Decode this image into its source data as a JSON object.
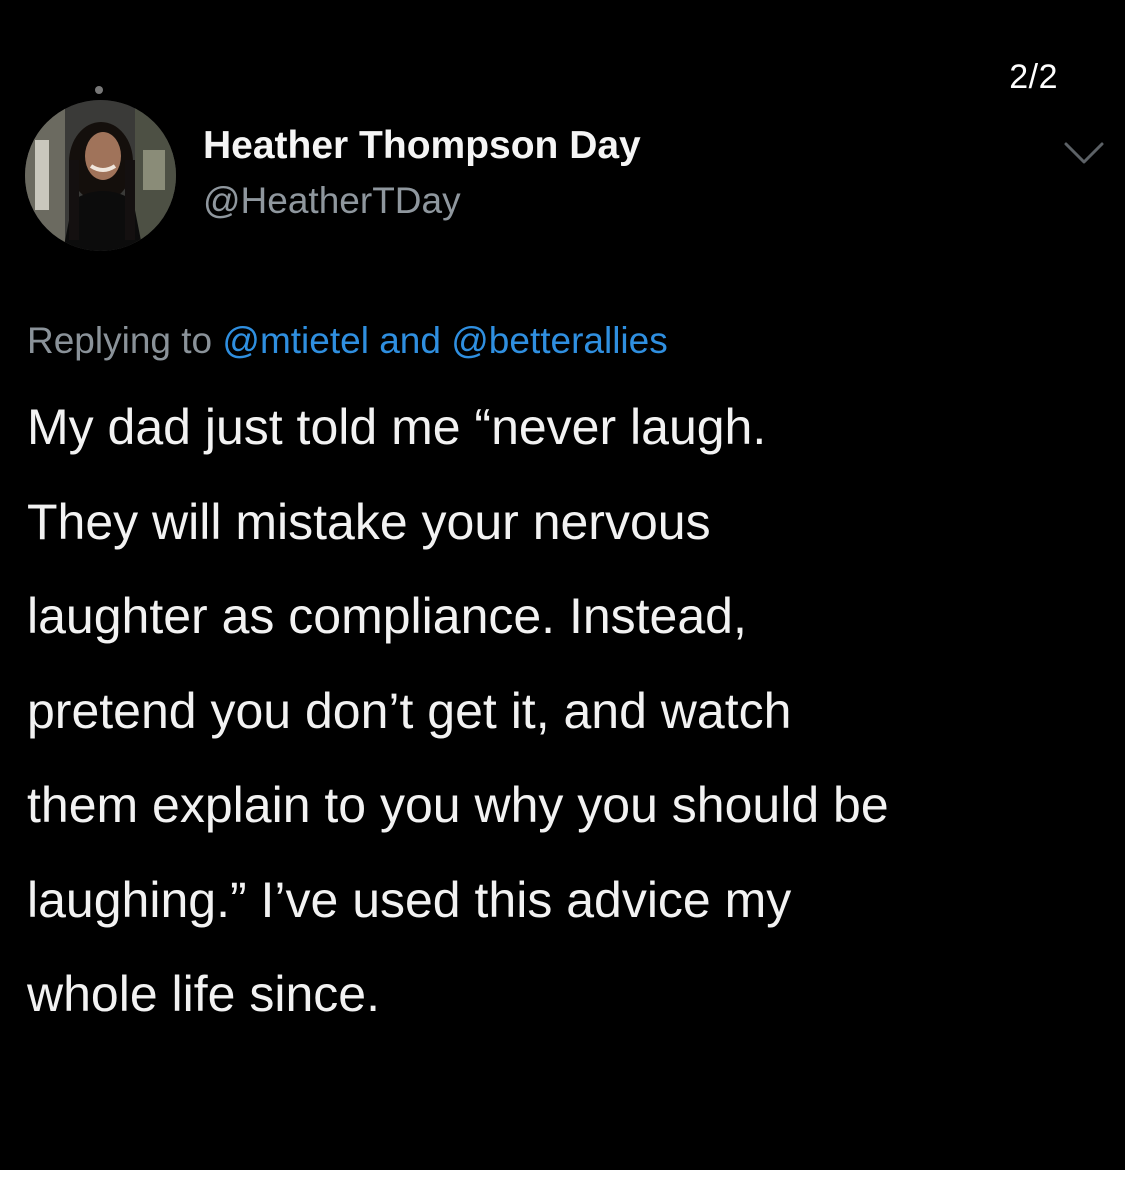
{
  "page_indicator": "2/2",
  "author": {
    "name": "Heather Thompson Day",
    "handle": "@HeatherTDay",
    "avatar_icon": "profile-photo"
  },
  "reply": {
    "prefix": "Replying to",
    "mention_1": "@mtietel",
    "conjunction": "and",
    "mention_2": "@betterallies"
  },
  "tweet": {
    "lines": [
      "My dad just told me “never laugh.",
      "They will mistake your nervous",
      "laughter as compliance. Instead,",
      "pretend you don’t get it, and watch",
      "them explain to you why you should be",
      "laughing.” I’ve used this advice my",
      "whole life since."
    ]
  },
  "colors": {
    "background": "#000000",
    "text": "#f2f2f2",
    "secondary_text": "#8a9299",
    "mention": "#2f8fe0"
  },
  "icons": {
    "menu": "chevron-down-icon"
  }
}
